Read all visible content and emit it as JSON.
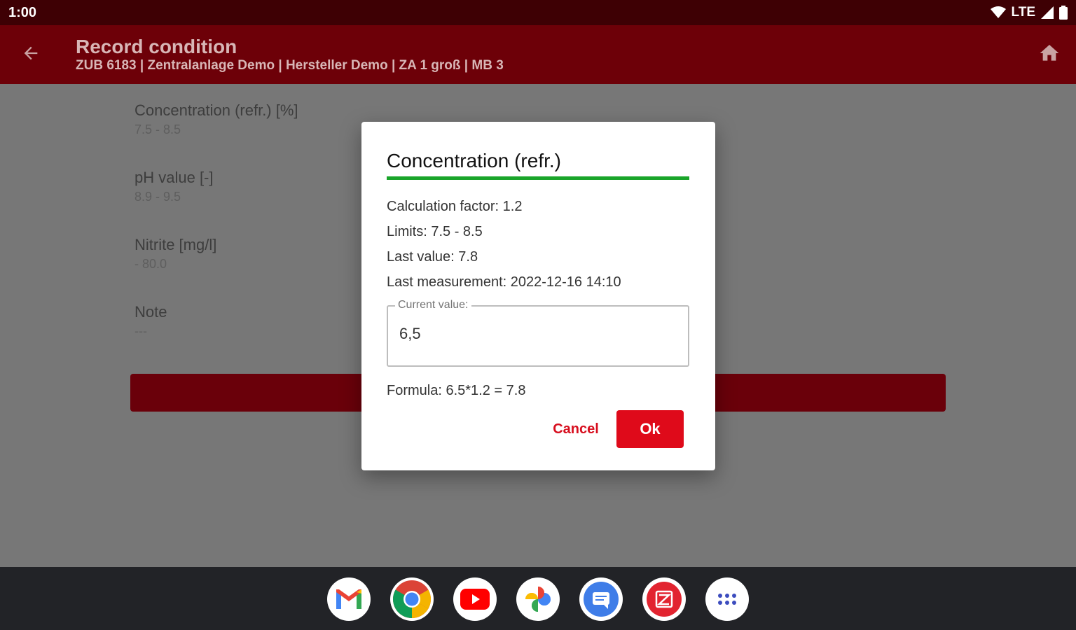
{
  "status_bar": {
    "time": "1:00",
    "network": "LTE",
    "icons": [
      "wifi-icon",
      "signal-icon",
      "battery-icon"
    ]
  },
  "app_bar": {
    "title": "Record condition",
    "subtitle": "ZUB 6183 | Zentralanlage Demo | Hersteller Demo | ZA 1 groß | MB 3",
    "back_icon": "arrow-back-icon",
    "home_icon": "home-icon"
  },
  "fields": [
    {
      "label": "Concentration (refr.) [%]",
      "value": "7.5 - 8.5"
    },
    {
      "label": "pH value [-]",
      "value": "8.9 - 9.5"
    },
    {
      "label": "Nitrite [mg/l]",
      "value": " - 80.0"
    },
    {
      "label": "Note",
      "value": "---"
    }
  ],
  "dialog": {
    "title": "Concentration (refr.)",
    "calculation_factor": "Calculation factor: 1.2",
    "limits": "Limits: 7.5 - 8.5",
    "last_value": "Last value: 7.8",
    "last_measurement": "Last measurement: 2022-12-16 14:10",
    "input_label": "Current value:",
    "input_value": "6,5",
    "formula": "Formula: 6.5*1.2 = 7.8",
    "cancel_label": "Cancel",
    "ok_label": "Ok"
  },
  "dock": {
    "apps": [
      "gmail-icon",
      "chrome-icon",
      "youtube-icon",
      "photos-icon",
      "messages-icon",
      "app-icon",
      "app-drawer-icon"
    ]
  },
  "colors": {
    "status_bar": "#3e0004",
    "app_bar": "#6d0008",
    "accent_red": "#df0a1a",
    "underline_green": "#1aa52a"
  }
}
